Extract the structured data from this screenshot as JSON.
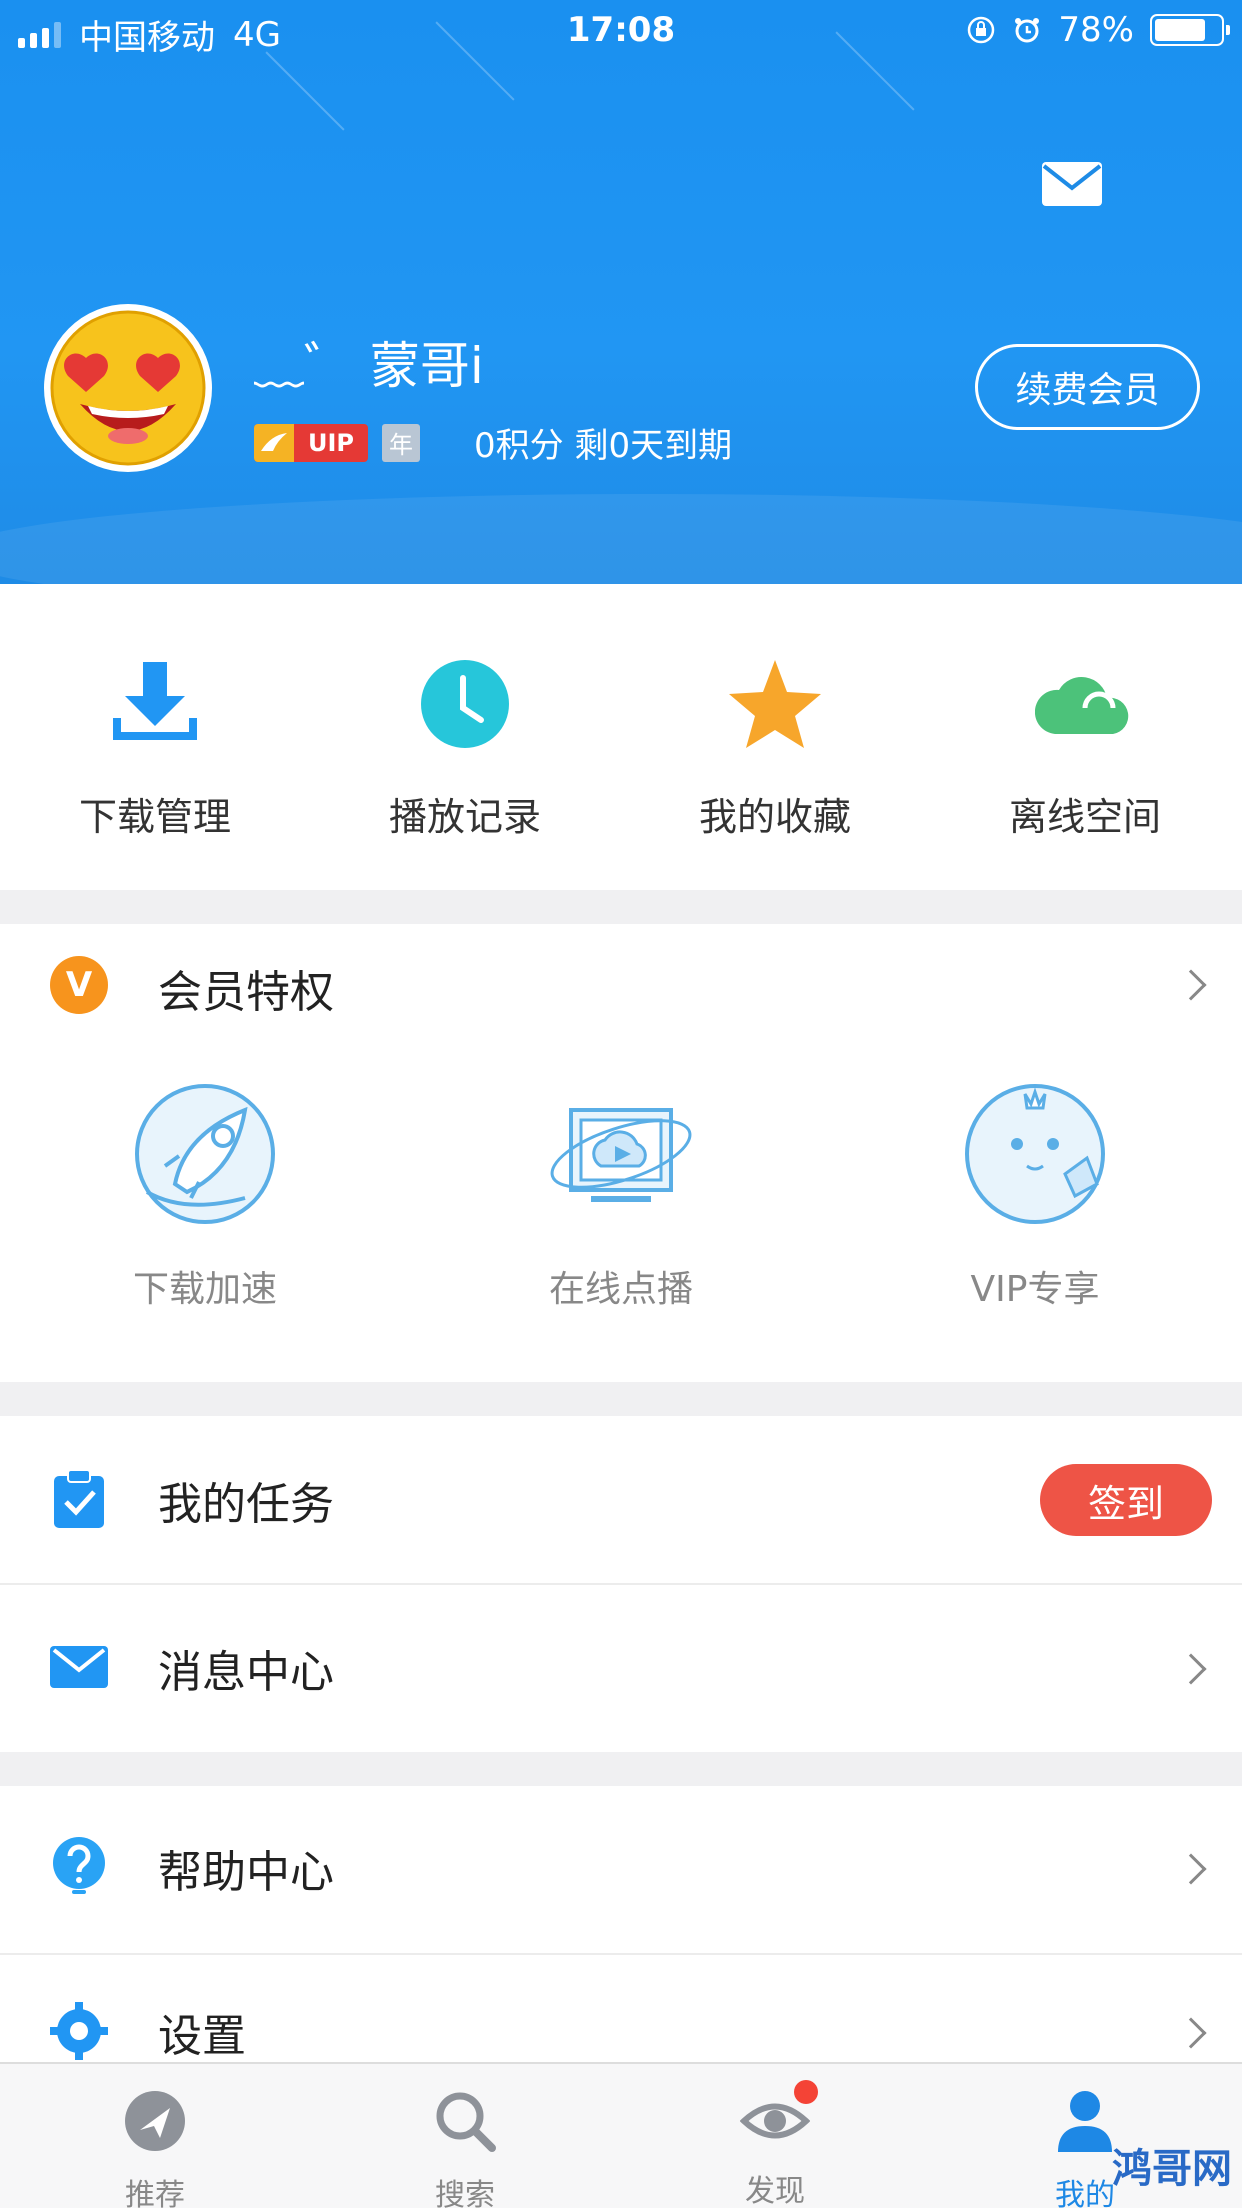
{
  "status_bar": {
    "carrier": "中国移动",
    "network": "4G",
    "time": "17:08",
    "battery": "78%"
  },
  "profile": {
    "username": "﹏゛ 蒙哥i",
    "vip_label": "UIP",
    "year_label": "年",
    "points_info": "0积分 剩0天到期",
    "renew_button": "续费会员"
  },
  "quick_actions": [
    {
      "label": "下载管理",
      "icon": "download-icon"
    },
    {
      "label": "播放记录",
      "icon": "clock-icon"
    },
    {
      "label": "我的收藏",
      "icon": "star-icon"
    },
    {
      "label": "离线空间",
      "icon": "cloud-icon"
    }
  ],
  "member": {
    "badge": "V",
    "title": "会员特权",
    "items": [
      {
        "label": "下载加速",
        "icon": "rocket-icon"
      },
      {
        "label": "在线点播",
        "icon": "video-screen-icon"
      },
      {
        "label": "VIP专享",
        "icon": "mascot-icon"
      }
    ]
  },
  "rows": {
    "tasks": "我的任务",
    "signin": "签到",
    "messages": "消息中心",
    "help": "帮助中心",
    "settings": "设置"
  },
  "tabs": [
    {
      "label": "推荐",
      "icon": "recommend-icon"
    },
    {
      "label": "搜索",
      "icon": "search-icon"
    },
    {
      "label": "发现",
      "icon": "eye-icon"
    },
    {
      "label": "我的",
      "icon": "user-icon"
    }
  ],
  "watermark": "鸿哥网",
  "colors": {
    "header_blue": "#2196f3",
    "signin_red": "#ee5446",
    "accent_orange": "#f7941d"
  }
}
